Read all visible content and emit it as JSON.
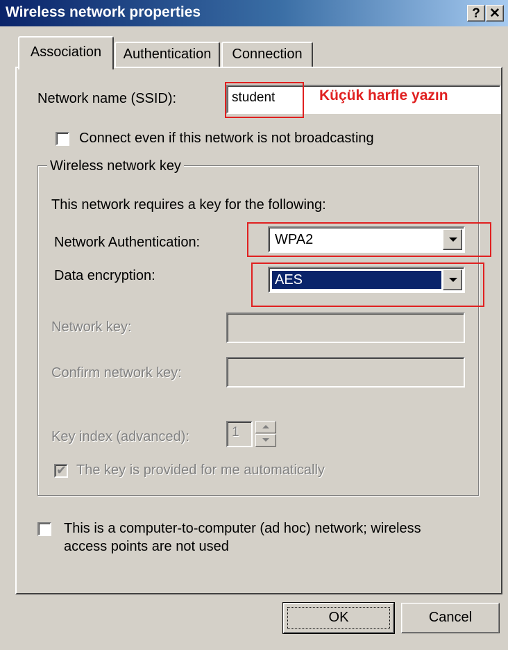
{
  "window": {
    "title": "Wireless network properties",
    "help_glyph": "?",
    "close_glyph": "✕"
  },
  "tabs": [
    {
      "label": "Association",
      "active": true
    },
    {
      "label": "Authentication",
      "active": false
    },
    {
      "label": "Connection",
      "active": false
    }
  ],
  "association": {
    "ssid_label": "Network name (SSID):",
    "ssid_value": "student",
    "annotation": "Küçük harfle yazın",
    "broadcast_label": "Connect even if this network is not broadcasting",
    "broadcast_checked": false
  },
  "key_group": {
    "title": "Wireless network key",
    "intro": "This network requires a key for the following:",
    "auth_label": "Network Authentication:",
    "auth_value": "WPA2",
    "encryption_label": "Data encryption:",
    "encryption_value": "AES",
    "network_key_label": "Network key:",
    "network_key_value": "",
    "confirm_key_label": "Confirm network key:",
    "confirm_key_value": "",
    "key_index_label": "Key index (advanced):",
    "key_index_value": "1",
    "auto_key_label": "The key is provided for me automatically",
    "auto_key_checked": true
  },
  "adhoc": {
    "label_line1": "This is a computer-to-computer (ad hoc) network; wireless",
    "label_line2": "access points are not used",
    "checked": false
  },
  "buttons": {
    "ok": "OK",
    "cancel": "Cancel"
  },
  "colors": {
    "dialog_face": "#d4d0c8",
    "titlebar_start": "#0a246a",
    "selection": "#0a246a",
    "annotation_red": "#e02020"
  }
}
